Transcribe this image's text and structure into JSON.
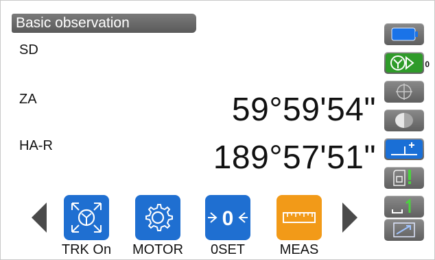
{
  "title": "Basic observation",
  "measurements": {
    "sd_label": "SD",
    "za_label": "ZA",
    "za_value": "59°59'54\"",
    "ha_label": "HA-R",
    "ha_value": "189°57'51\""
  },
  "side_panel": {
    "prism_constant": "0",
    "icons": [
      "battery-icon",
      "target-prism-icon",
      "crosshair-icon",
      "laser-pointer-icon",
      "tilt-icon",
      "edm-mode-icon",
      "input-mode-icon",
      "keyboard-icon"
    ]
  },
  "function_keys": {
    "trk_label": "TRK On",
    "motor_label": "MOTOR",
    "zero_set_label": "0SET",
    "meas_label": "MEAS"
  },
  "colors": {
    "function_blue": "#1f6fd1",
    "meas_orange": "#f29a18",
    "battery_blue": "#1a73e8",
    "status_green": "#2f9b2a"
  }
}
